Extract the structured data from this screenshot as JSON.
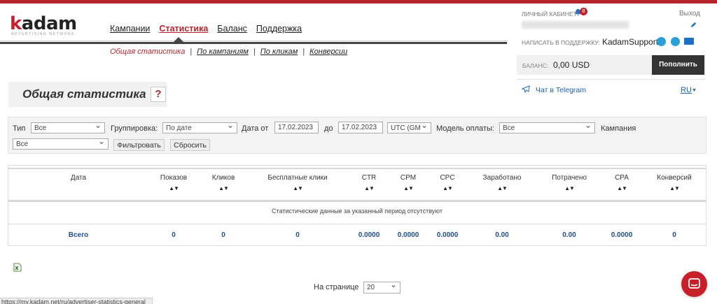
{
  "brand": {
    "logo_k": "k",
    "logo_rest": "adam",
    "logo_sub": "advertising network"
  },
  "nav": {
    "items": [
      {
        "label": "Кампании",
        "active": false
      },
      {
        "label": "Статистика",
        "active": true
      },
      {
        "label": "Баланс",
        "active": false
      },
      {
        "label": "Поддержка",
        "active": false
      }
    ]
  },
  "subnav": {
    "items": [
      {
        "label": "Общая статистика",
        "active": true
      },
      {
        "label": "По кампаниям",
        "active": false
      },
      {
        "label": "По кликам",
        "active": false
      },
      {
        "label": "Конверсии",
        "active": false
      }
    ],
    "separator": "|"
  },
  "page": {
    "title": "Общая статистика",
    "help": "?"
  },
  "account": {
    "cabinet_label": "Личный кабинет",
    "notifications": "0",
    "exit": "Выход",
    "support_label": "Написать в поддержку:",
    "support_name": "KadamSupport",
    "balance_label": "Баланс:",
    "balance_value": "0,00 USD",
    "topup": "Пополнить",
    "telegram": "Чат в Telegram",
    "lang": "RU"
  },
  "filters": {
    "type_label": "Тип",
    "type_value": "Все",
    "group_label": "Группировка:",
    "group_value": "По дате",
    "date_from_label": "Дата от",
    "date_from": "17.02.2023",
    "date_to_label": "до",
    "date_to": "17.02.2023",
    "tz_value": "UTC (GM",
    "pay_label": "Модель оплаты:",
    "pay_value": "Все",
    "campaign_label": "Кампания",
    "campaign_value": "Все",
    "filter_btn": "Фильтровать",
    "reset_btn": "Сбросить"
  },
  "table": {
    "columns": [
      "Дата",
      "Показов",
      "Кликов",
      "Бесплатные клики",
      "CTR",
      "CPM",
      "CPC",
      "Заработано",
      "Потрачено",
      "CPA",
      "Конверсий"
    ],
    "sort_glyph": "▲▼",
    "empty_message": "Статистические данные за указанный период отсутствуют",
    "totals": [
      "Всего",
      "0",
      "0",
      "0",
      "0.0000",
      "0.0000",
      "0.0000",
      "0.00",
      "0.00",
      "0.0000",
      "0"
    ]
  },
  "pagination": {
    "label": "На странице",
    "value": "20"
  },
  "status_url": "https://my.kadam.net/ru/advertiser-statistics-general",
  "colors": {
    "brand_red": "#b8242d",
    "link_blue": "#1d4f8c"
  }
}
